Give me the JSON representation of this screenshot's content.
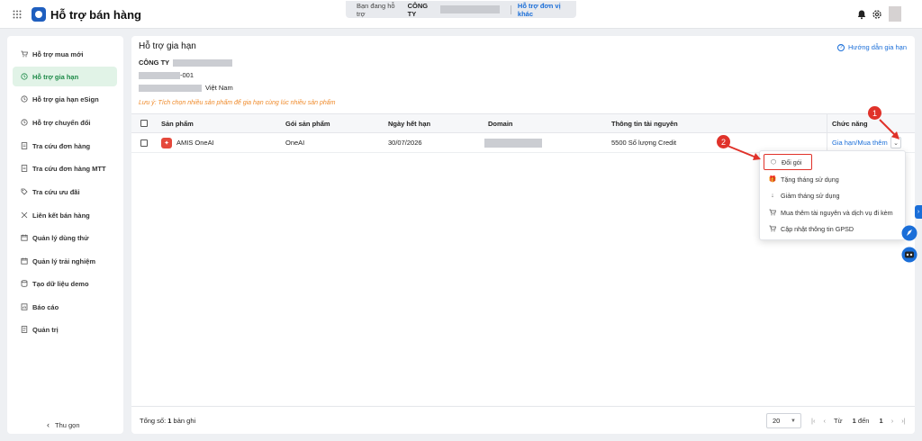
{
  "header": {
    "app_title": "Hỗ trợ bán hàng",
    "support_prefix": "Bạn đang hỗ trợ",
    "support_company": "CÔNG TY",
    "support_other_link": "Hỗ trợ đơn vị khác"
  },
  "sidebar": {
    "items": [
      {
        "label": "Hỗ trợ mua mới",
        "icon": "cart-icon",
        "active": false
      },
      {
        "label": "Hỗ trợ gia hạn",
        "icon": "clock-renew-icon",
        "active": true
      },
      {
        "label": "Hỗ trợ gia hạn eSign",
        "icon": "clock-renew-icon",
        "active": false
      },
      {
        "label": "Hỗ trợ chuyển đổi",
        "icon": "clock-renew-icon",
        "active": false
      },
      {
        "label": "Tra cứu đơn hàng",
        "icon": "document-icon",
        "active": false
      },
      {
        "label": "Tra cứu đơn hàng MTT",
        "icon": "document-icon",
        "active": false
      },
      {
        "label": "Tra cứu ưu đãi",
        "icon": "tag-icon",
        "active": false
      },
      {
        "label": "Liên kết bán hàng",
        "icon": "link-icon",
        "active": false
      },
      {
        "label": "Quản lý dùng thử",
        "icon": "calendar-icon",
        "active": false
      },
      {
        "label": "Quản lý trải nghiệm",
        "icon": "calendar-icon",
        "active": false
      },
      {
        "label": "Tạo dữ liệu demo",
        "icon": "database-icon",
        "active": false
      },
      {
        "label": "Báo cáo",
        "icon": "report-icon",
        "active": false
      },
      {
        "label": "Quản trị",
        "icon": "admin-icon",
        "active": false
      }
    ],
    "collapse_label": "Thu gọn"
  },
  "main": {
    "title": "Hỗ trợ gia hạn",
    "guide_link": "Hướng dẫn gia hạn",
    "company_label": "CÔNG TY",
    "tax_suffix": "-001",
    "address_suffix": "Việt Nam",
    "note": "Lưu ý: Tích chọn nhiều sản phẩm để gia hạn cùng lúc nhiều sản phẩm"
  },
  "table": {
    "columns": [
      "Sản phẩm",
      "Gói sản phẩm",
      "Ngày hết hạn",
      "Domain",
      "Thông tin tài nguyên",
      "Chức năng"
    ],
    "rows": [
      {
        "product": "AMIS OneAI",
        "package": "OneAI",
        "expiry": "30/07/2026",
        "resources": "5500 Số lượng Credit",
        "action": "Gia hạn/Mua thêm"
      }
    ]
  },
  "dropdown_menu": {
    "items": [
      {
        "label": "Đổi gói",
        "icon": "box-icon"
      },
      {
        "label": "Tặng tháng sử dụng",
        "icon": "gift-icon"
      },
      {
        "label": "Giảm tháng sử dụng",
        "icon": "arrow-down-icon"
      },
      {
        "label": "Mua thêm tài nguyên và dịch vụ đi kèm",
        "icon": "cart-icon"
      },
      {
        "label": "Cập nhật thông tin GPSD",
        "icon": "cart-icon"
      }
    ]
  },
  "annotations": {
    "badge_1": "1",
    "badge_2": "2",
    "color": "#e0322a"
  },
  "footer": {
    "total_prefix": "Tổng số:",
    "total_count": "1",
    "total_suffix": "bản ghi",
    "page_size": "20",
    "range_prefix": "Từ",
    "range_from": "1",
    "range_mid": "đến",
    "range_to": "1"
  },
  "colors": {
    "accent": "#1a6ed8",
    "active_green": "#1d8a48",
    "note_orange": "#ef8a2a",
    "product_red": "#e5483b"
  }
}
